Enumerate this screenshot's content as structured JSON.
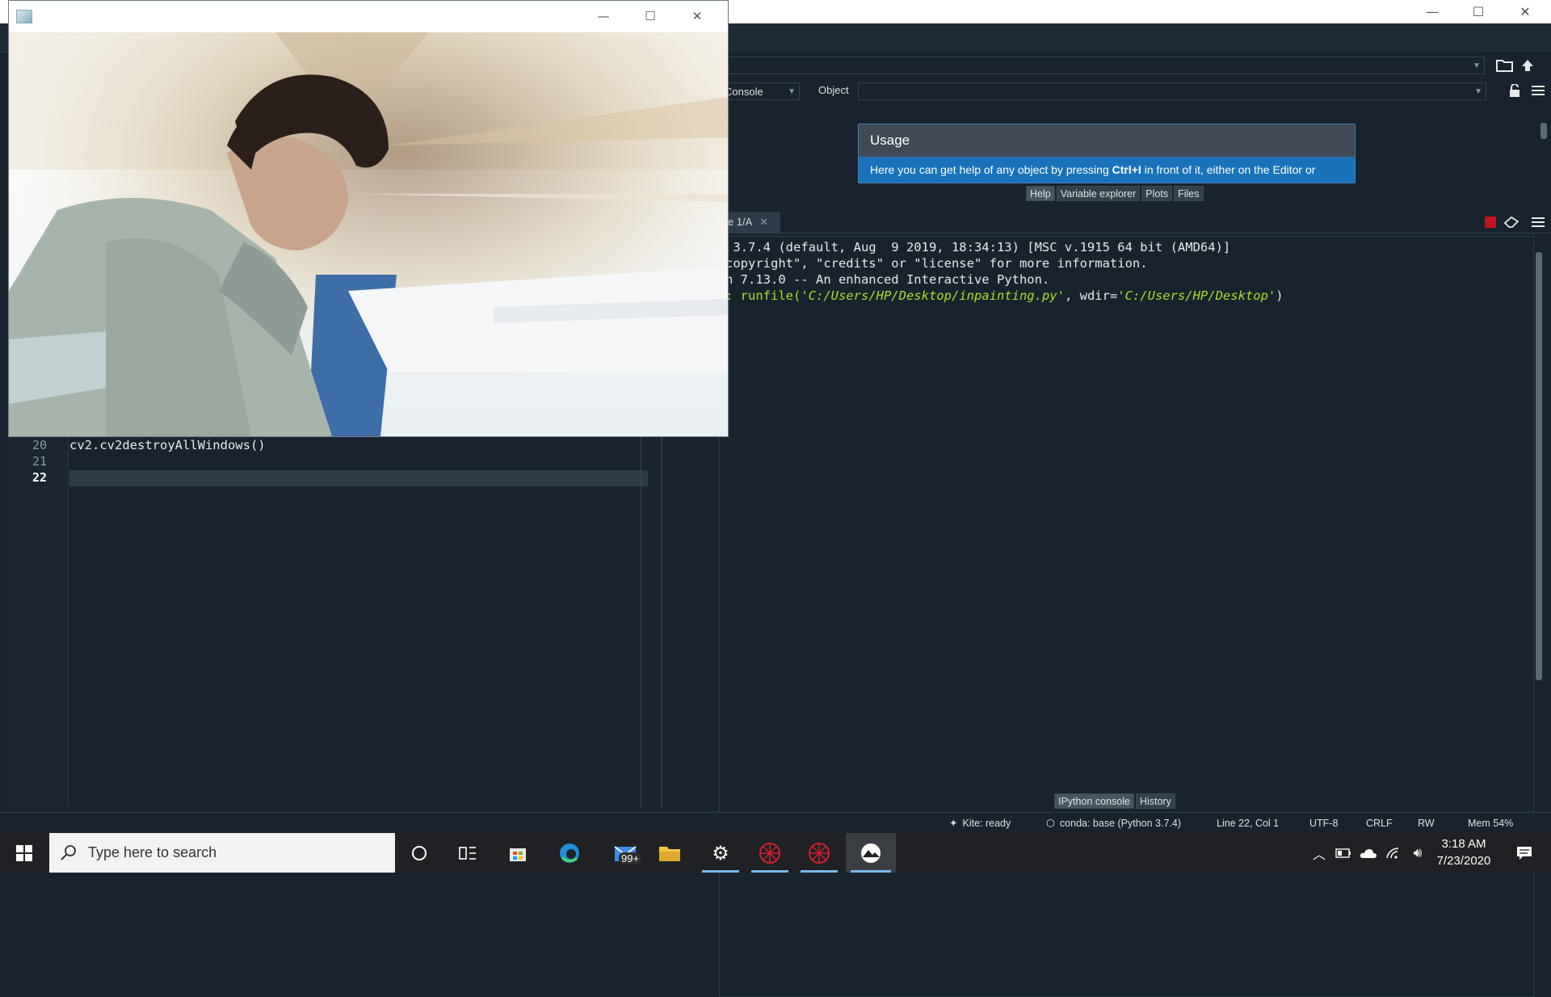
{
  "spyder": {
    "window_controls": [
      "—",
      "☐",
      "✕"
    ],
    "help": {
      "source_label": "Console",
      "object_label": "Object",
      "usage_title": "Usage",
      "usage_text_pre": "Here you can get help of any object by pressing ",
      "usage_shortcut": "Ctrl+I",
      "usage_text_post": " in front of it, either on the Editor or",
      "tabs": [
        "Help",
        "Variable explorer",
        "Plots",
        "Files"
      ],
      "active_tab": "Help"
    },
    "console": {
      "tab_label": "le 1/A",
      "lines": [
        " 3.7.4 (default, Aug  9 2019, 18:34:13) [MSC v.1915 64 bit (AMD64)]",
        "copyright\", \"credits\" or \"license\" for more information.",
        "",
        "n 7.13.0 -- An enhanced Interactive Python.",
        ""
      ],
      "run_prefix": ": runfile(",
      "run_path": "'C:/Users/HP/Desktop/inpainting.py'",
      "run_mid": ", wdir=",
      "run_wdir": "'C:/Users/HP/Desktop'",
      "run_suffix": ")",
      "bottom_tabs": [
        "IPython console",
        "History"
      ],
      "active_bottom_tab": "IPython console"
    },
    "editor": {
      "line_numbers": [
        "20",
        "21",
        "22"
      ],
      "current_line": "22",
      "code": [
        "cv2.cv2destroyAllWindows()",
        "",
        ""
      ]
    },
    "statusbar": {
      "kite": "Kite: ready",
      "conda": "conda: base (Python 3.7.4)",
      "position": "Line 22, Col 1",
      "encoding": "UTF-8",
      "eol": "CRLF",
      "mode": "RW",
      "mem": "Mem 54%"
    }
  },
  "image_window": {
    "controls": [
      "—",
      "☐",
      "✕"
    ]
  },
  "taskbar": {
    "search_placeholder": "Type here to search",
    "mail_badge": "99+",
    "time": "3:18 AM",
    "date": "7/23/2020",
    "accent": "#76b9ed"
  }
}
